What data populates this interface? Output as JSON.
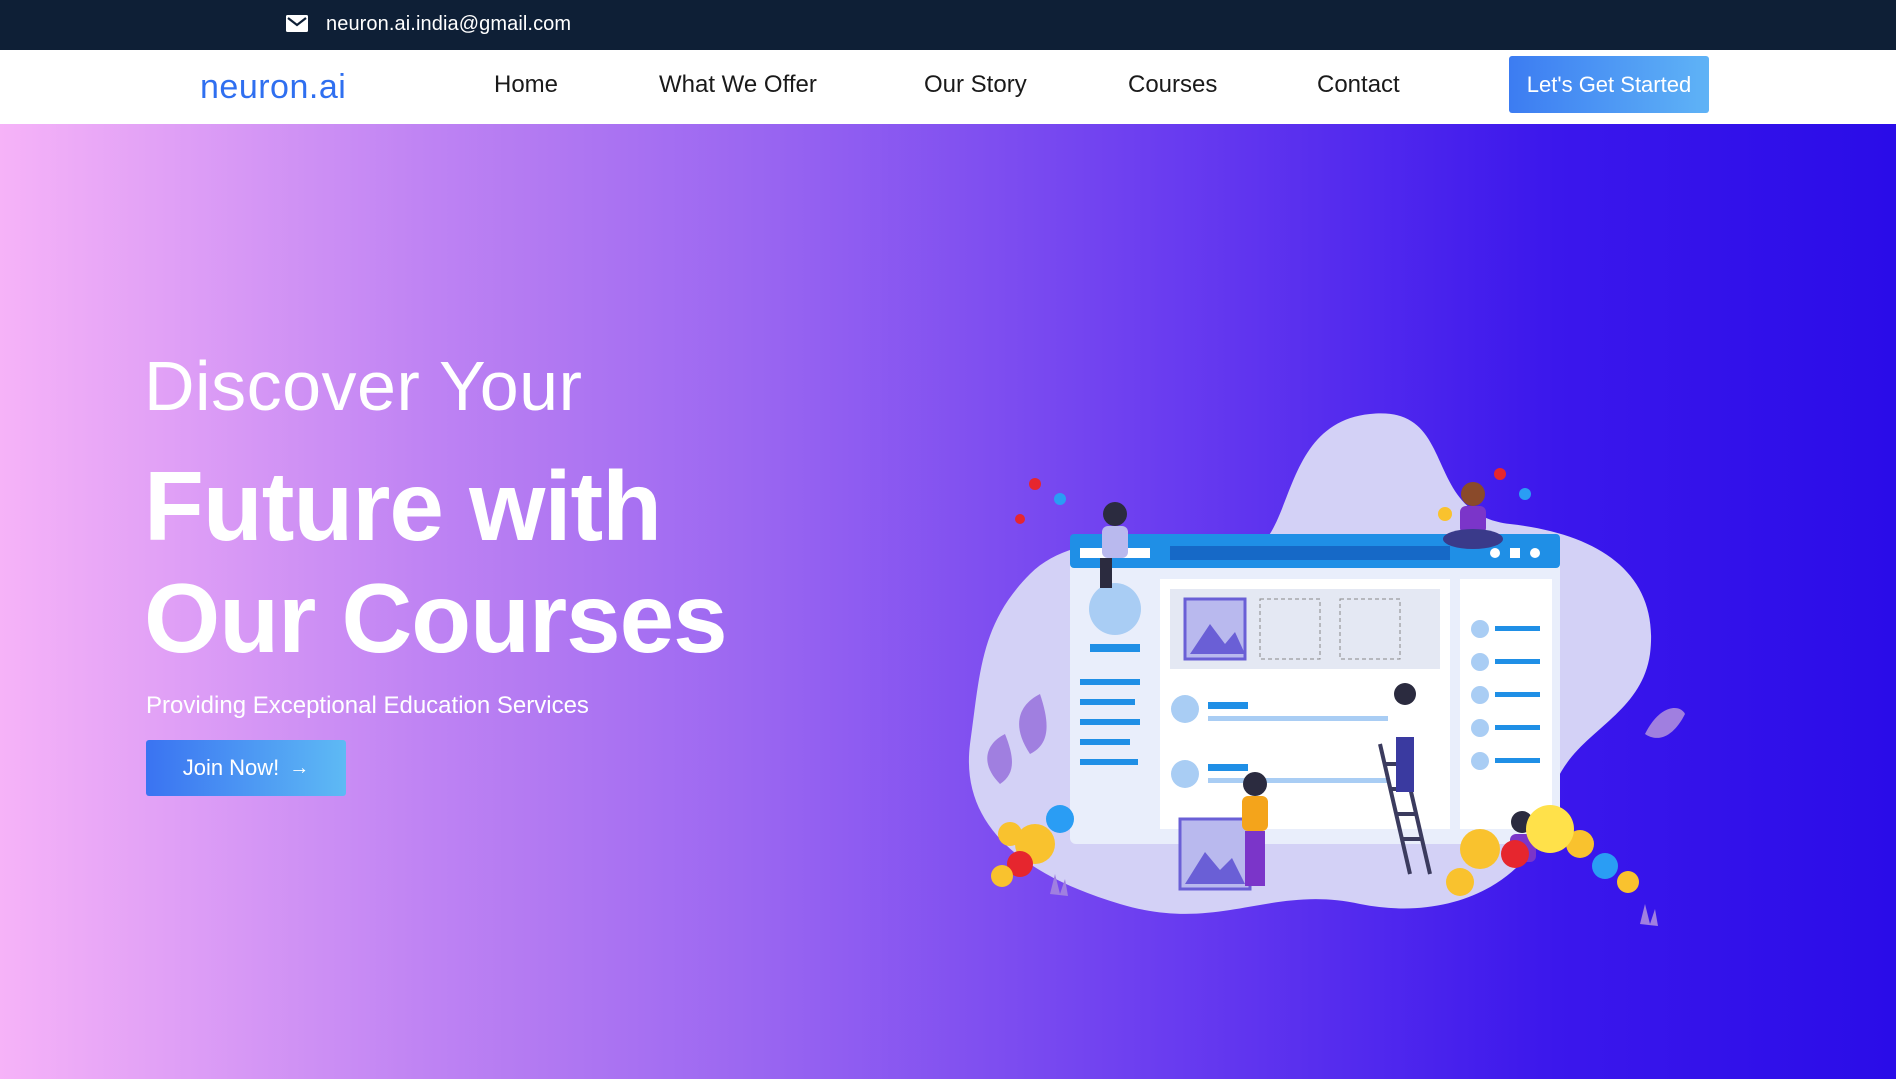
{
  "topbar": {
    "email": "neuron.ai.india@gmail.com",
    "mail_icon": "mail-icon"
  },
  "nav": {
    "logo": "neuron.ai",
    "items": [
      {
        "label": "Home"
      },
      {
        "label": "What We Offer"
      },
      {
        "label": "Our Story"
      },
      {
        "label": "Courses"
      },
      {
        "label": "Contact"
      }
    ],
    "cta": "Let's Get Started"
  },
  "hero": {
    "line1": "Discover Your",
    "line2": "Future with",
    "line3": "Our Courses",
    "subtitle": "Providing Exceptional Education Services",
    "button": "Join Now!",
    "button_icon": "arrow-right-icon"
  },
  "colors": {
    "topbar": "#0e1f36",
    "brand": "#2f6ff0",
    "hero_start": "#f6b3f8",
    "hero_end": "#2a0ce8"
  }
}
